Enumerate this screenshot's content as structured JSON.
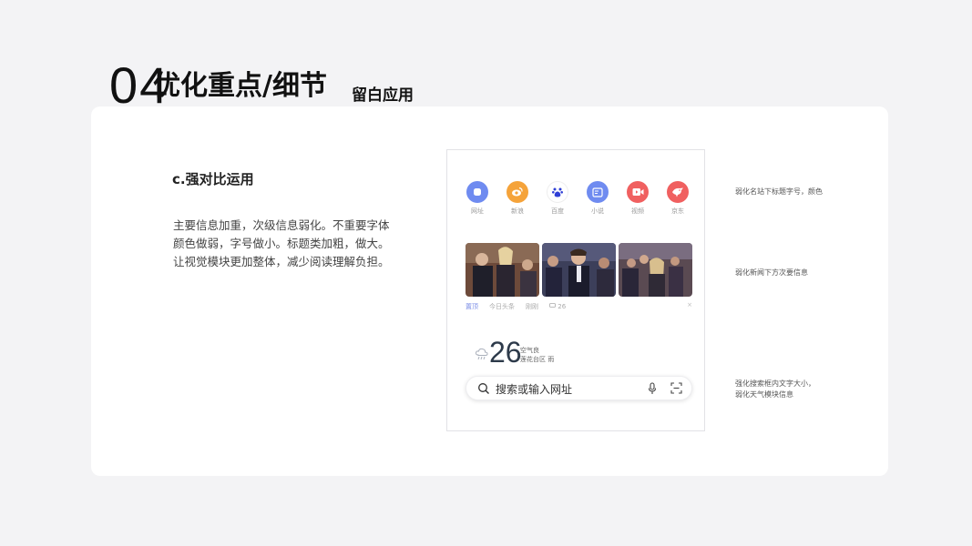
{
  "header": {
    "number": "04",
    "title": "优化重点/细节",
    "subtitle": "留白应用"
  },
  "content": {
    "section_title": "c.强对比运用",
    "description_lines": [
      "主要信息加重，次级信息弱化。不重要字体",
      "颜色做弱，字号做小。标题类加粗，做大。",
      "让视觉模块更加整体，减少阅读理解负担。"
    ]
  },
  "phone": {
    "shortcuts": [
      {
        "label": "网址",
        "icon": "url-icon",
        "color": "#6f8bf0"
      },
      {
        "label": "新浪",
        "icon": "sina-icon",
        "color": "#f5a33a"
      },
      {
        "label": "百度",
        "icon": "baidu-icon",
        "color": "#ffffff"
      },
      {
        "label": "小说",
        "icon": "novel-icon",
        "color": "#6f8bf0"
      },
      {
        "label": "视频",
        "icon": "video-icon",
        "color": "#f06060"
      },
      {
        "label": "京东",
        "icon": "jd-icon",
        "color": "#f06060"
      }
    ],
    "news_meta": {
      "tag": "置顶",
      "source": "今日头条",
      "time": "刚刚",
      "comments": "26",
      "close": "×"
    },
    "weather": {
      "temperature": "26",
      "line1": "空气良",
      "line2": "莲花台区 雨"
    },
    "search": {
      "placeholder": "搜索或输入网址"
    }
  },
  "notes": [
    "弱化名站下标题字号，颜色",
    "弱化新闻下方次要信息",
    "强化搜索框内文字大小，",
    "弱化天气模块信息"
  ]
}
